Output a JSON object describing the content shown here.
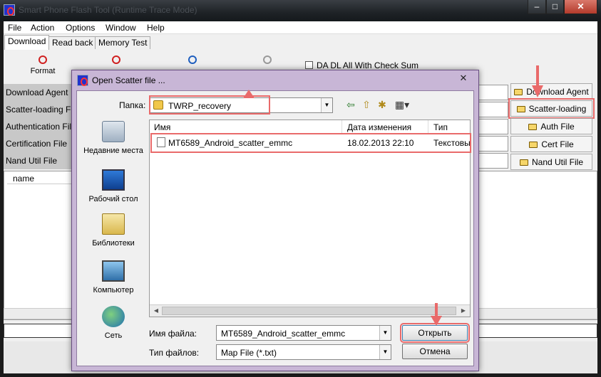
{
  "window": {
    "title": "Smart Phone Flash Tool (Runtime Trace Mode)",
    "colors": {
      "title_bar": "#1e2226",
      "close": "#c54c3d",
      "highlight": "#e96a6a",
      "dialog_frame": "#c8b6d6"
    }
  },
  "menu": [
    "File",
    "Action",
    "Options",
    "Window",
    "Help"
  ],
  "tabs": [
    "Download",
    "Read back",
    "Memory Test"
  ],
  "toolbar": {
    "format_label": "Format",
    "checksum_label": "DA DL All With Check Sum"
  },
  "file_rows": [
    "Download Agent",
    "Scatter-loading File",
    "Authentication File",
    "Certification File",
    "Nand Util File"
  ],
  "side_buttons": [
    "Download Agent",
    "Scatter-loading",
    "Auth File",
    "Cert File",
    "Nand Util File"
  ],
  "list": {
    "column": "name"
  },
  "dialog": {
    "title": "Open Scatter file ...",
    "close_glyph": "✕",
    "look_in_label": "Папка:",
    "look_in_value": "TWRP_recovery",
    "places": [
      "Недавние места",
      "Рабочий стол",
      "Библиотеки",
      "Компьютер",
      "Сеть"
    ],
    "columns": [
      "Имя",
      "Дата изменения",
      "Тип"
    ],
    "files": [
      {
        "name": "MT6589_Android_scatter_emmc",
        "date": "18.02.2013 22:10",
        "type": "Текстовы"
      }
    ],
    "filename_label": "Имя файла:",
    "filename_value": "MT6589_Android_scatter_emmc",
    "filetype_label": "Тип файлов:",
    "filetype_value": "Map File (*.txt)",
    "open_button": "Открыть",
    "cancel_button": "Отмена"
  }
}
